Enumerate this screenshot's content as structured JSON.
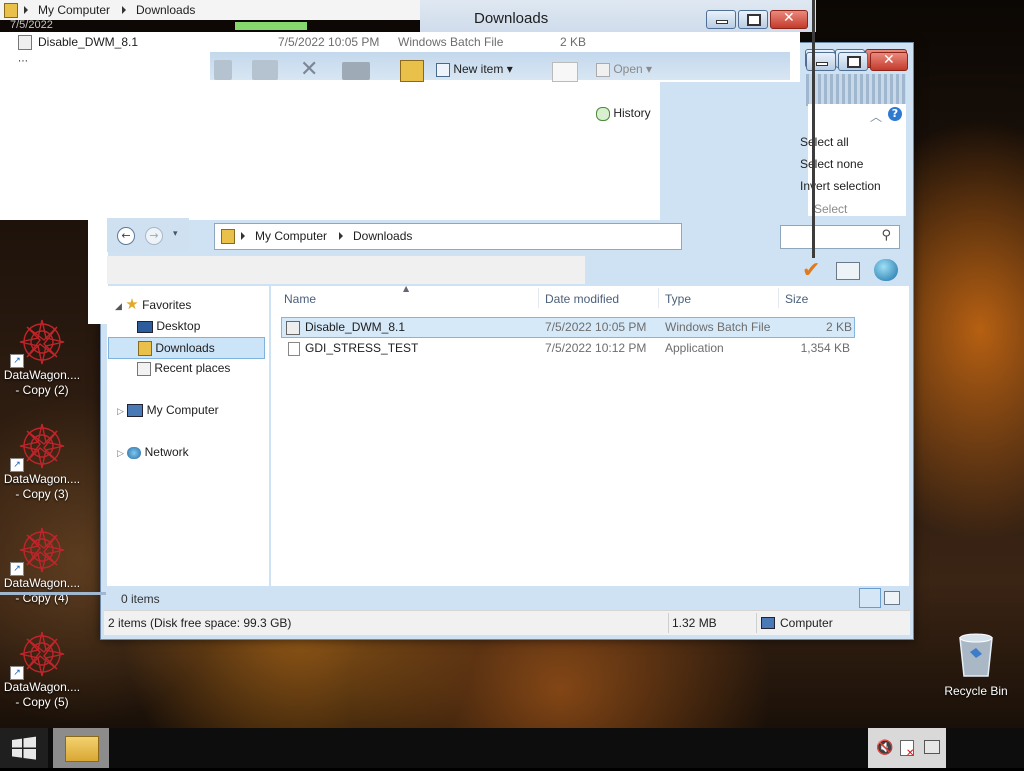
{
  "window": {
    "title": "Downloads"
  },
  "ghost": {
    "crumb_root": "My Computer",
    "crumb_current": "Downloads",
    "stray_date": "7/5/2022",
    "stray_row": {
      "name": "Disable_DWM_8.1",
      "date": "7/5/2022 10:05 PM",
      "type": "Windows Batch File",
      "size": "2 KB"
    },
    "new_item": "New item",
    "open": "Open",
    "history": "History"
  },
  "ribbon": {
    "select_all": "Select all",
    "select_none": "Select none",
    "invert_selection": "Invert selection",
    "group_select": "Select"
  },
  "address": {
    "root": "My Computer",
    "current": "Downloads"
  },
  "nav": {
    "favorites": "Favorites",
    "desktop": "Desktop",
    "downloads": "Downloads",
    "recent": "Recent places",
    "computer": "My Computer",
    "network": "Network"
  },
  "columns": {
    "name": "Name",
    "date": "Date modified",
    "type": "Type",
    "size": "Size"
  },
  "files": [
    {
      "name": "Disable_DWM_8.1",
      "date": "7/5/2022 10:05 PM",
      "type": "Windows Batch File",
      "size": "2 KB",
      "selected": true
    },
    {
      "name": "GDI_STRESS_TEST",
      "date": "7/5/2022 10:12 PM",
      "type": "Application",
      "size": "1,354 KB",
      "selected": false
    }
  ],
  "status": {
    "items_pane": "0 items",
    "summary": "2 items (Disk free space: 99.3 GB)",
    "size": "1.32 MB",
    "location": "Computer"
  },
  "desktop_icons": [
    {
      "line1": "DataWagon....",
      "line2": "- Copy (2)"
    },
    {
      "line1": "DataWagon....",
      "line2": "- Copy (3)"
    },
    {
      "line1": "DataWagon....",
      "line2": "- Copy (4)"
    },
    {
      "line1": "DataWagon....",
      "line2": "- Copy (5)"
    }
  ],
  "recycle_bin": "Recycle Bin",
  "colors": {
    "selection": "#d6e9f8",
    "frame": "#cfe2f3",
    "accent": "#1a5fb4"
  }
}
